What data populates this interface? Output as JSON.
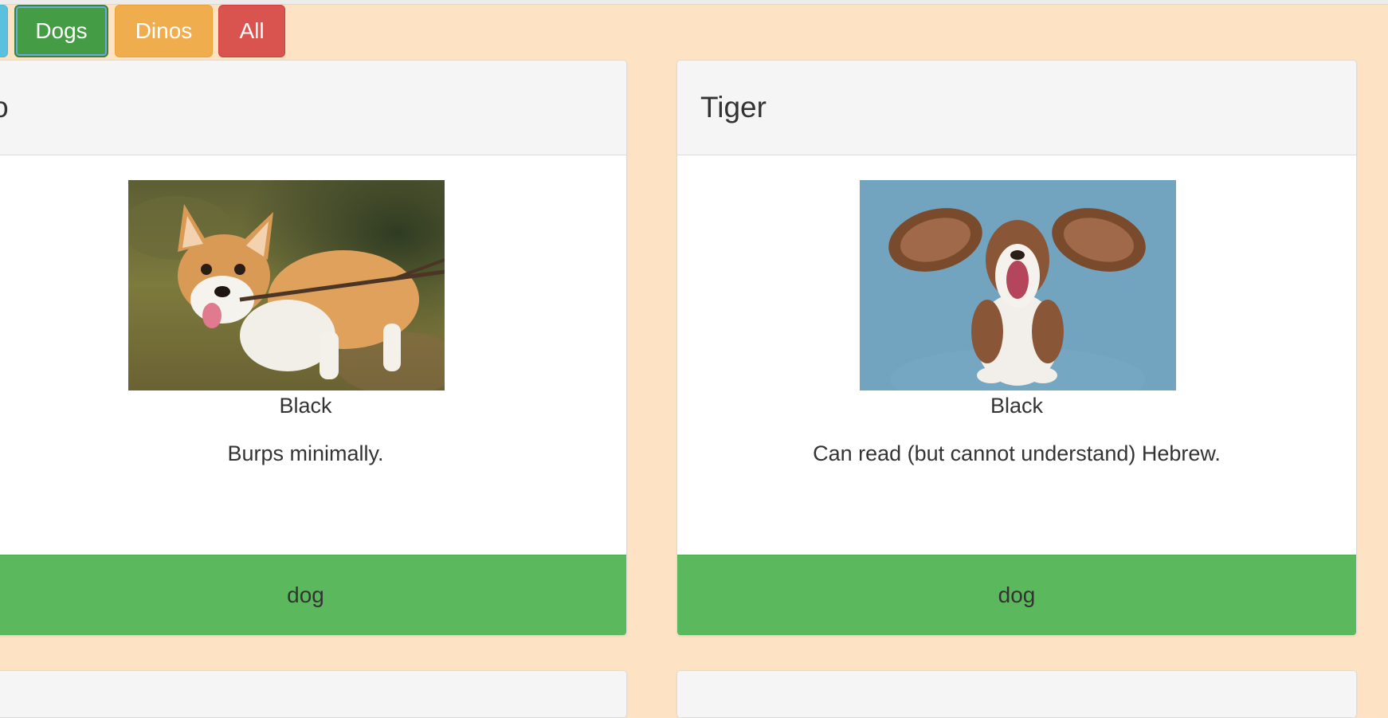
{
  "filters": {
    "cats_label": "",
    "dogs_label": "Dogs",
    "dinos_label": "Dinos",
    "all_label": "All"
  },
  "cards": [
    {
      "name": "oco",
      "image": "corgi holding stick",
      "color": "Black",
      "description": "Burps minimally.",
      "type": "dog"
    },
    {
      "name": "Tiger",
      "image": "basset hound with flying ears",
      "color": "Black",
      "description": "Can read (but cannot understand) Hebrew.",
      "type": "dog"
    }
  ],
  "colors": {
    "background": "#fde3c4",
    "dogs_button": "#449d44",
    "dinos_button": "#f0ad4e",
    "all_button": "#d9534f",
    "cats_button": "#5bc0de",
    "footer": "#5cb85c"
  }
}
